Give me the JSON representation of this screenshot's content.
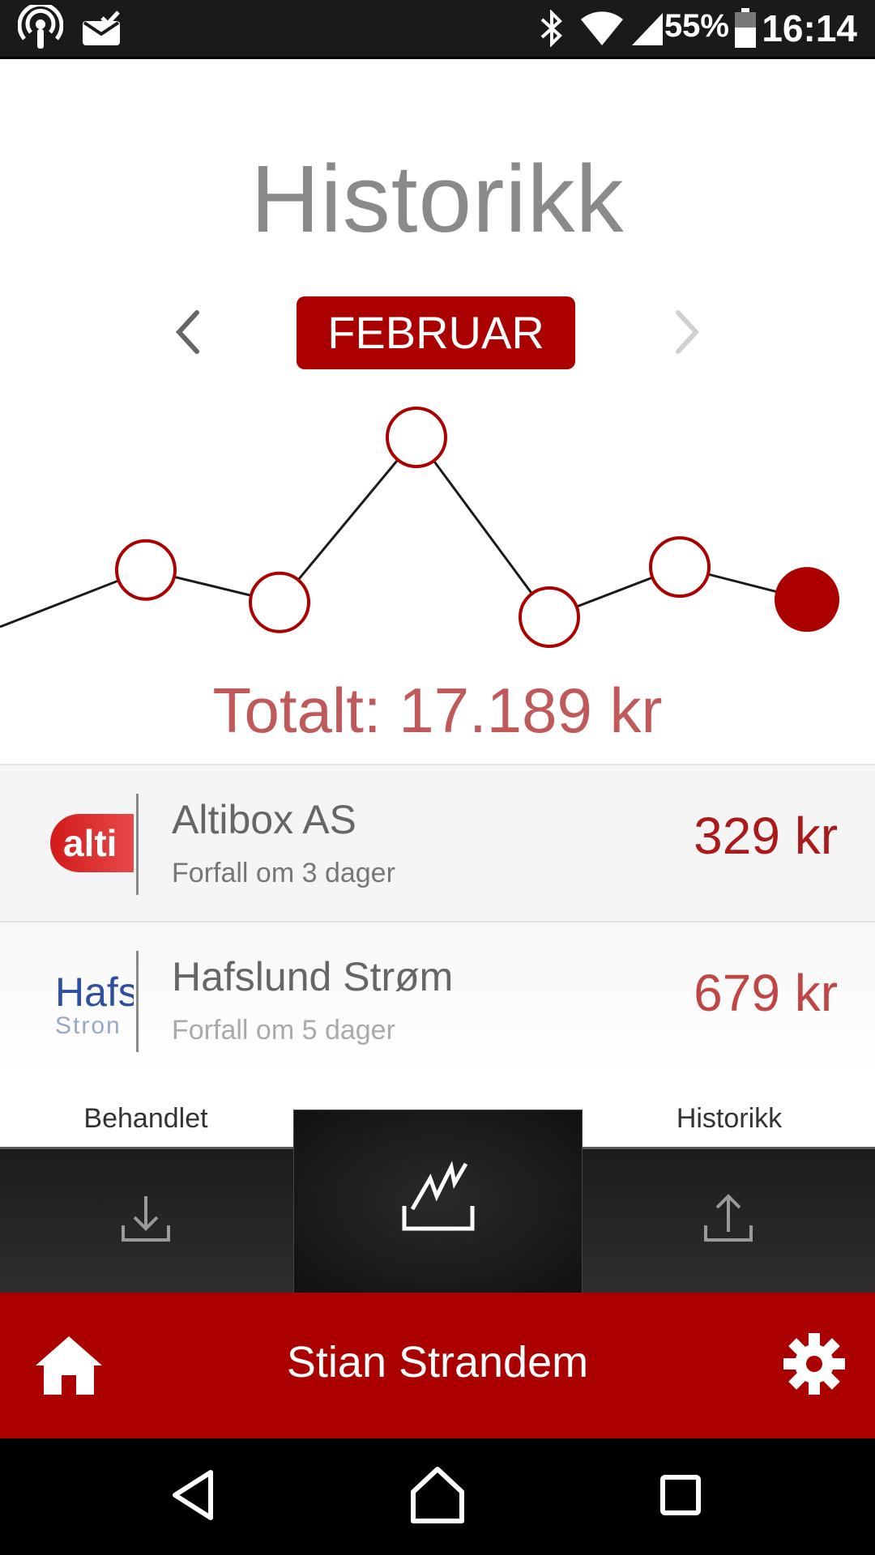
{
  "status_bar": {
    "icons_left": [
      "podcast-icon",
      "mail-check-icon"
    ],
    "icons_right": [
      "bluetooth-icon",
      "wifi-icon",
      "signal-icon",
      "battery-icon"
    ],
    "battery": "55%",
    "time": "16:14"
  },
  "header": {
    "title": "Historikk",
    "month": "FEBRUAR",
    "prev_icon": "chevron-left-icon",
    "next_icon": "chevron-right-icon"
  },
  "chart_data": {
    "type": "line",
    "series": [
      {
        "values": [
          null,
          0.55,
          0.44,
          1.0,
          0.39,
          0.56,
          0.45
        ]
      }
    ],
    "highlighted_index": 6,
    "line_color": "#1a1a1a",
    "marker_color": "#aa0000"
  },
  "total": "Totalt: 17.189 kr",
  "bills": [
    {
      "logo_text": "alti",
      "name": "Altibox AS",
      "due": "Forfall om 3 dager",
      "amount": "329 kr"
    },
    {
      "logo_text": "Hafs",
      "logo_sub": "Stron",
      "name": "Hafslund Strøm",
      "due": "Forfall om 5 dager",
      "amount": "679 kr"
    }
  ],
  "tabs": {
    "left_label": "Behandlet",
    "right_label": "Historikk",
    "left_icon": "download-icon",
    "center_icon": "chart-icon",
    "right_icon": "upload-icon"
  },
  "footer": {
    "user_name": "Stian Strandem",
    "home_icon": "home-icon",
    "settings_icon": "gear-icon"
  },
  "colors": {
    "accent": "#aa0000",
    "status_bar": "#1a1a1a",
    "tab_bar": "#252525"
  }
}
